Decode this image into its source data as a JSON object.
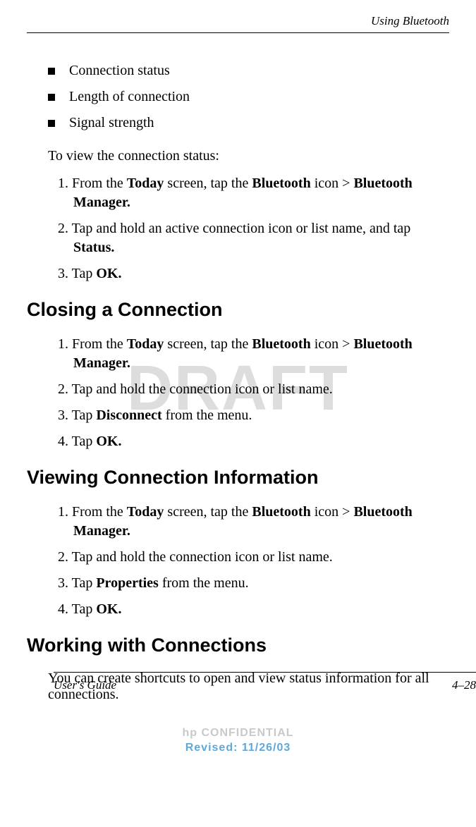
{
  "header": {
    "running_title": "Using Bluetooth"
  },
  "bullets": [
    "Connection status",
    "Length of connection",
    "Signal strength"
  ],
  "intro_para": "To view the connection status:",
  "steps_intro": {
    "s1_a": "1. From the ",
    "s1_b": "Today",
    "s1_c": " screen, tap the ",
    "s1_d": "Bluetooth",
    "s1_e": " icon > ",
    "s1_f": "Bluetooth Manager.",
    "s2_a": "2. Tap and hold an active connection icon or list name, and tap ",
    "s2_b": "Status.",
    "s3_a": "3. Tap ",
    "s3_b": "OK."
  },
  "heading_close": "Closing a Connection",
  "steps_close": {
    "s1_a": "1. From the ",
    "s1_b": "Today",
    "s1_c": " screen, tap the ",
    "s1_d": "Bluetooth",
    "s1_e": " icon > ",
    "s1_f": "Bluetooth Manager.",
    "s2": "2. Tap and hold the connection icon or list name.",
    "s3_a": "3. Tap ",
    "s3_b": "Disconnect",
    "s3_c": " from the menu.",
    "s4_a": "4. Tap ",
    "s4_b": "OK."
  },
  "heading_view": "Viewing Connection Information",
  "steps_view": {
    "s1_a": "1. From the ",
    "s1_b": "Today",
    "s1_c": " screen, tap the ",
    "s1_d": "Bluetooth",
    "s1_e": " icon > ",
    "s1_f": "Bluetooth Manager.",
    "s2": "2. Tap and hold the connection icon or list name.",
    "s3_a": "3. Tap ",
    "s3_b": "Properties",
    "s3_c": " from the menu.",
    "s4_a": "4. Tap ",
    "s4_b": "OK."
  },
  "heading_work": "Working with Connections",
  "work_para": "You can create shortcuts to open and view status information for all connections.",
  "footer": {
    "left": "User's Guide",
    "right": "4–28"
  },
  "confidential": {
    "line1": "hp CONFIDENTIAL",
    "line2": "Revised: 11/26/03"
  },
  "watermark": "DRAFT"
}
